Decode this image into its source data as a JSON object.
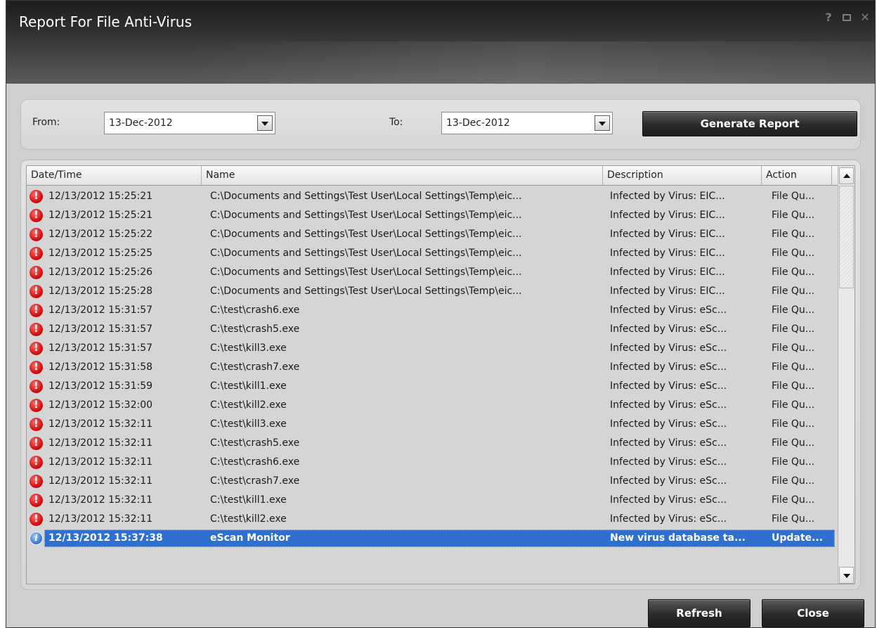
{
  "window": {
    "title": "Report For File Anti-Virus",
    "controls": {
      "help": "?",
      "maximize": "maximize-icon",
      "close": "✕"
    }
  },
  "filter": {
    "from_label": "From:",
    "from_value": "13-Dec-2012",
    "to_label": "To:",
    "to_value": "13-Dec-2012",
    "generate_label": "Generate Report"
  },
  "table": {
    "headers": [
      "Date/Time",
      "Name",
      "Description",
      "Action"
    ],
    "rows": [
      {
        "icon": "alert-icon",
        "datetime": "12/13/2012 15:25:21",
        "name": "C:\\Documents and Settings\\Test User\\Local Settings\\Temp\\eic...",
        "description": "Infected by Virus: EIC...",
        "action": "File Qu..."
      },
      {
        "icon": "alert-icon",
        "datetime": "12/13/2012 15:25:21",
        "name": "C:\\Documents and Settings\\Test User\\Local Settings\\Temp\\eic...",
        "description": "Infected by Virus: EIC...",
        "action": "File Qu..."
      },
      {
        "icon": "alert-icon",
        "datetime": "12/13/2012 15:25:22",
        "name": "C:\\Documents and Settings\\Test User\\Local Settings\\Temp\\eic...",
        "description": "Infected by Virus: EIC...",
        "action": "File Qu..."
      },
      {
        "icon": "alert-icon",
        "datetime": "12/13/2012 15:25:25",
        "name": "C:\\Documents and Settings\\Test User\\Local Settings\\Temp\\eic...",
        "description": "Infected by Virus: EIC...",
        "action": "File Qu..."
      },
      {
        "icon": "alert-icon",
        "datetime": "12/13/2012 15:25:26",
        "name": "C:\\Documents and Settings\\Test User\\Local Settings\\Temp\\eic...",
        "description": "Infected by Virus: EIC...",
        "action": "File Qu..."
      },
      {
        "icon": "alert-icon",
        "datetime": "12/13/2012 15:25:28",
        "name": "C:\\Documents and Settings\\Test User\\Local Settings\\Temp\\eic...",
        "description": "Infected by Virus: EIC...",
        "action": "File Qu..."
      },
      {
        "icon": "alert-icon",
        "datetime": "12/13/2012 15:31:57",
        "name": "C:\\test\\crash6.exe",
        "description": "Infected by Virus: eSc...",
        "action": "File Qu..."
      },
      {
        "icon": "alert-icon",
        "datetime": "12/13/2012 15:31:57",
        "name": "C:\\test\\crash5.exe",
        "description": "Infected by Virus: eSc...",
        "action": "File Qu..."
      },
      {
        "icon": "alert-icon",
        "datetime": "12/13/2012 15:31:57",
        "name": "C:\\test\\kill3.exe",
        "description": "Infected by Virus: eSc...",
        "action": "File Qu..."
      },
      {
        "icon": "alert-icon",
        "datetime": "12/13/2012 15:31:58",
        "name": "C:\\test\\crash7.exe",
        "description": "Infected by Virus: eSc...",
        "action": "File Qu..."
      },
      {
        "icon": "alert-icon",
        "datetime": "12/13/2012 15:31:59",
        "name": "C:\\test\\kill1.exe",
        "description": "Infected by Virus: eSc...",
        "action": "File Qu..."
      },
      {
        "icon": "alert-icon",
        "datetime": "12/13/2012 15:32:00",
        "name": "C:\\test\\kill2.exe",
        "description": "Infected by Virus: eSc...",
        "action": "File Qu..."
      },
      {
        "icon": "alert-icon",
        "datetime": "12/13/2012 15:32:11",
        "name": "C:\\test\\kill3.exe",
        "description": "Infected by Virus: eSc...",
        "action": "File Qu..."
      },
      {
        "icon": "alert-icon",
        "datetime": "12/13/2012 15:32:11",
        "name": "C:\\test\\crash5.exe",
        "description": "Infected by Virus: eSc...",
        "action": "File Qu..."
      },
      {
        "icon": "alert-icon",
        "datetime": "12/13/2012 15:32:11",
        "name": "C:\\test\\crash6.exe",
        "description": "Infected by Virus: eSc...",
        "action": "File Qu..."
      },
      {
        "icon": "alert-icon",
        "datetime": "12/13/2012 15:32:11",
        "name": "C:\\test\\crash7.exe",
        "description": "Infected by Virus: eSc...",
        "action": "File Qu..."
      },
      {
        "icon": "alert-icon",
        "datetime": "12/13/2012 15:32:11",
        "name": "C:\\test\\kill1.exe",
        "description": "Infected by Virus: eSc...",
        "action": "File Qu..."
      },
      {
        "icon": "alert-icon",
        "datetime": "12/13/2012 15:32:11",
        "name": "C:\\test\\kill2.exe",
        "description": "Infected by Virus: eSc...",
        "action": "File Qu..."
      },
      {
        "icon": "info-icon",
        "datetime": "12/13/2012 15:37:38",
        "name": "eScan Monitor",
        "description": "New virus database ta...",
        "action": "Update...",
        "selected": true
      }
    ]
  },
  "footer": {
    "refresh_label": "Refresh",
    "close_label": "Close"
  },
  "colors": {
    "selection": "#2f6fd0",
    "alert": "#d41010",
    "titlebar": "#2f2f2f"
  }
}
